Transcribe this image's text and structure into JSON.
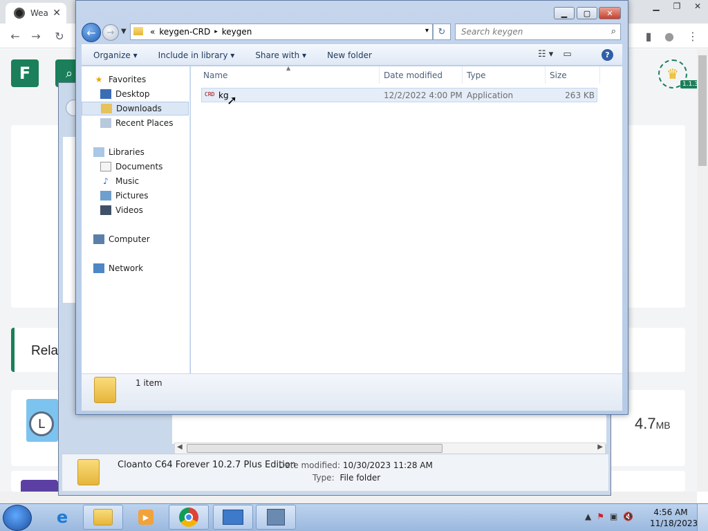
{
  "browser": {
    "tab_title": "Wea",
    "tab_close": "✕",
    "window_controls": [
      "▁",
      "❐",
      "✕"
    ],
    "nav": {
      "back": "←",
      "forward": "→",
      "reload": "↻"
    },
    "toolbar_icons": {
      "sidebar": "▮",
      "account": "●",
      "menu": "⋮"
    }
  },
  "site": {
    "logo": "F",
    "search_icon": "⌕",
    "version": "1.1.3",
    "related_label": "Rela",
    "file_size": "4.7",
    "file_size_unit": "MB",
    "brand_color": "#1a7f5a"
  },
  "bg_explorer": {
    "folder_name": "Cloanto C64 Forever 10.2.7 Plus Edition",
    "date_modified_label": "Date modified:",
    "date_modified_value": "10/30/2023 11:28 AM",
    "type_label": "Type:",
    "type_value": "File folder"
  },
  "explorer": {
    "window_buttons": {
      "minimize": "▁",
      "maximize": "▢",
      "close": "✕"
    },
    "address": {
      "prefix": "«",
      "segments": [
        "keygen-CRD",
        "keygen"
      ],
      "separator": "▸",
      "dropdown": "▾"
    },
    "refresh_icon": "↻",
    "search_placeholder": "Search keygen",
    "search_icon": "⌕",
    "commands": [
      "Organize ▾",
      "Include in library ▾",
      "Share with ▾",
      "New folder"
    ],
    "view_icons": [
      "☷ ▾",
      "▭"
    ],
    "help": "?",
    "nav": {
      "favorites": {
        "title": "Favorites",
        "items": [
          "Desktop",
          "Downloads",
          "Recent Places"
        ]
      },
      "libraries": {
        "title": "Libraries",
        "items": [
          "Documents",
          "Music",
          "Pictures",
          "Videos"
        ]
      },
      "computer": "Computer",
      "network": "Network"
    },
    "columns": [
      "Name",
      "Date modified",
      "Type",
      "Size"
    ],
    "files": [
      {
        "icon": "CRD",
        "name": "kg",
        "date": "12/2/2022 4:00 PM",
        "type": "Application",
        "size": "263 KB"
      }
    ],
    "status": "1 item"
  },
  "taskbar": {
    "time": "4:56 AM",
    "date": "11/18/2023",
    "tray_icons": [
      "▲",
      "⚑",
      "▣",
      "🔇"
    ]
  }
}
